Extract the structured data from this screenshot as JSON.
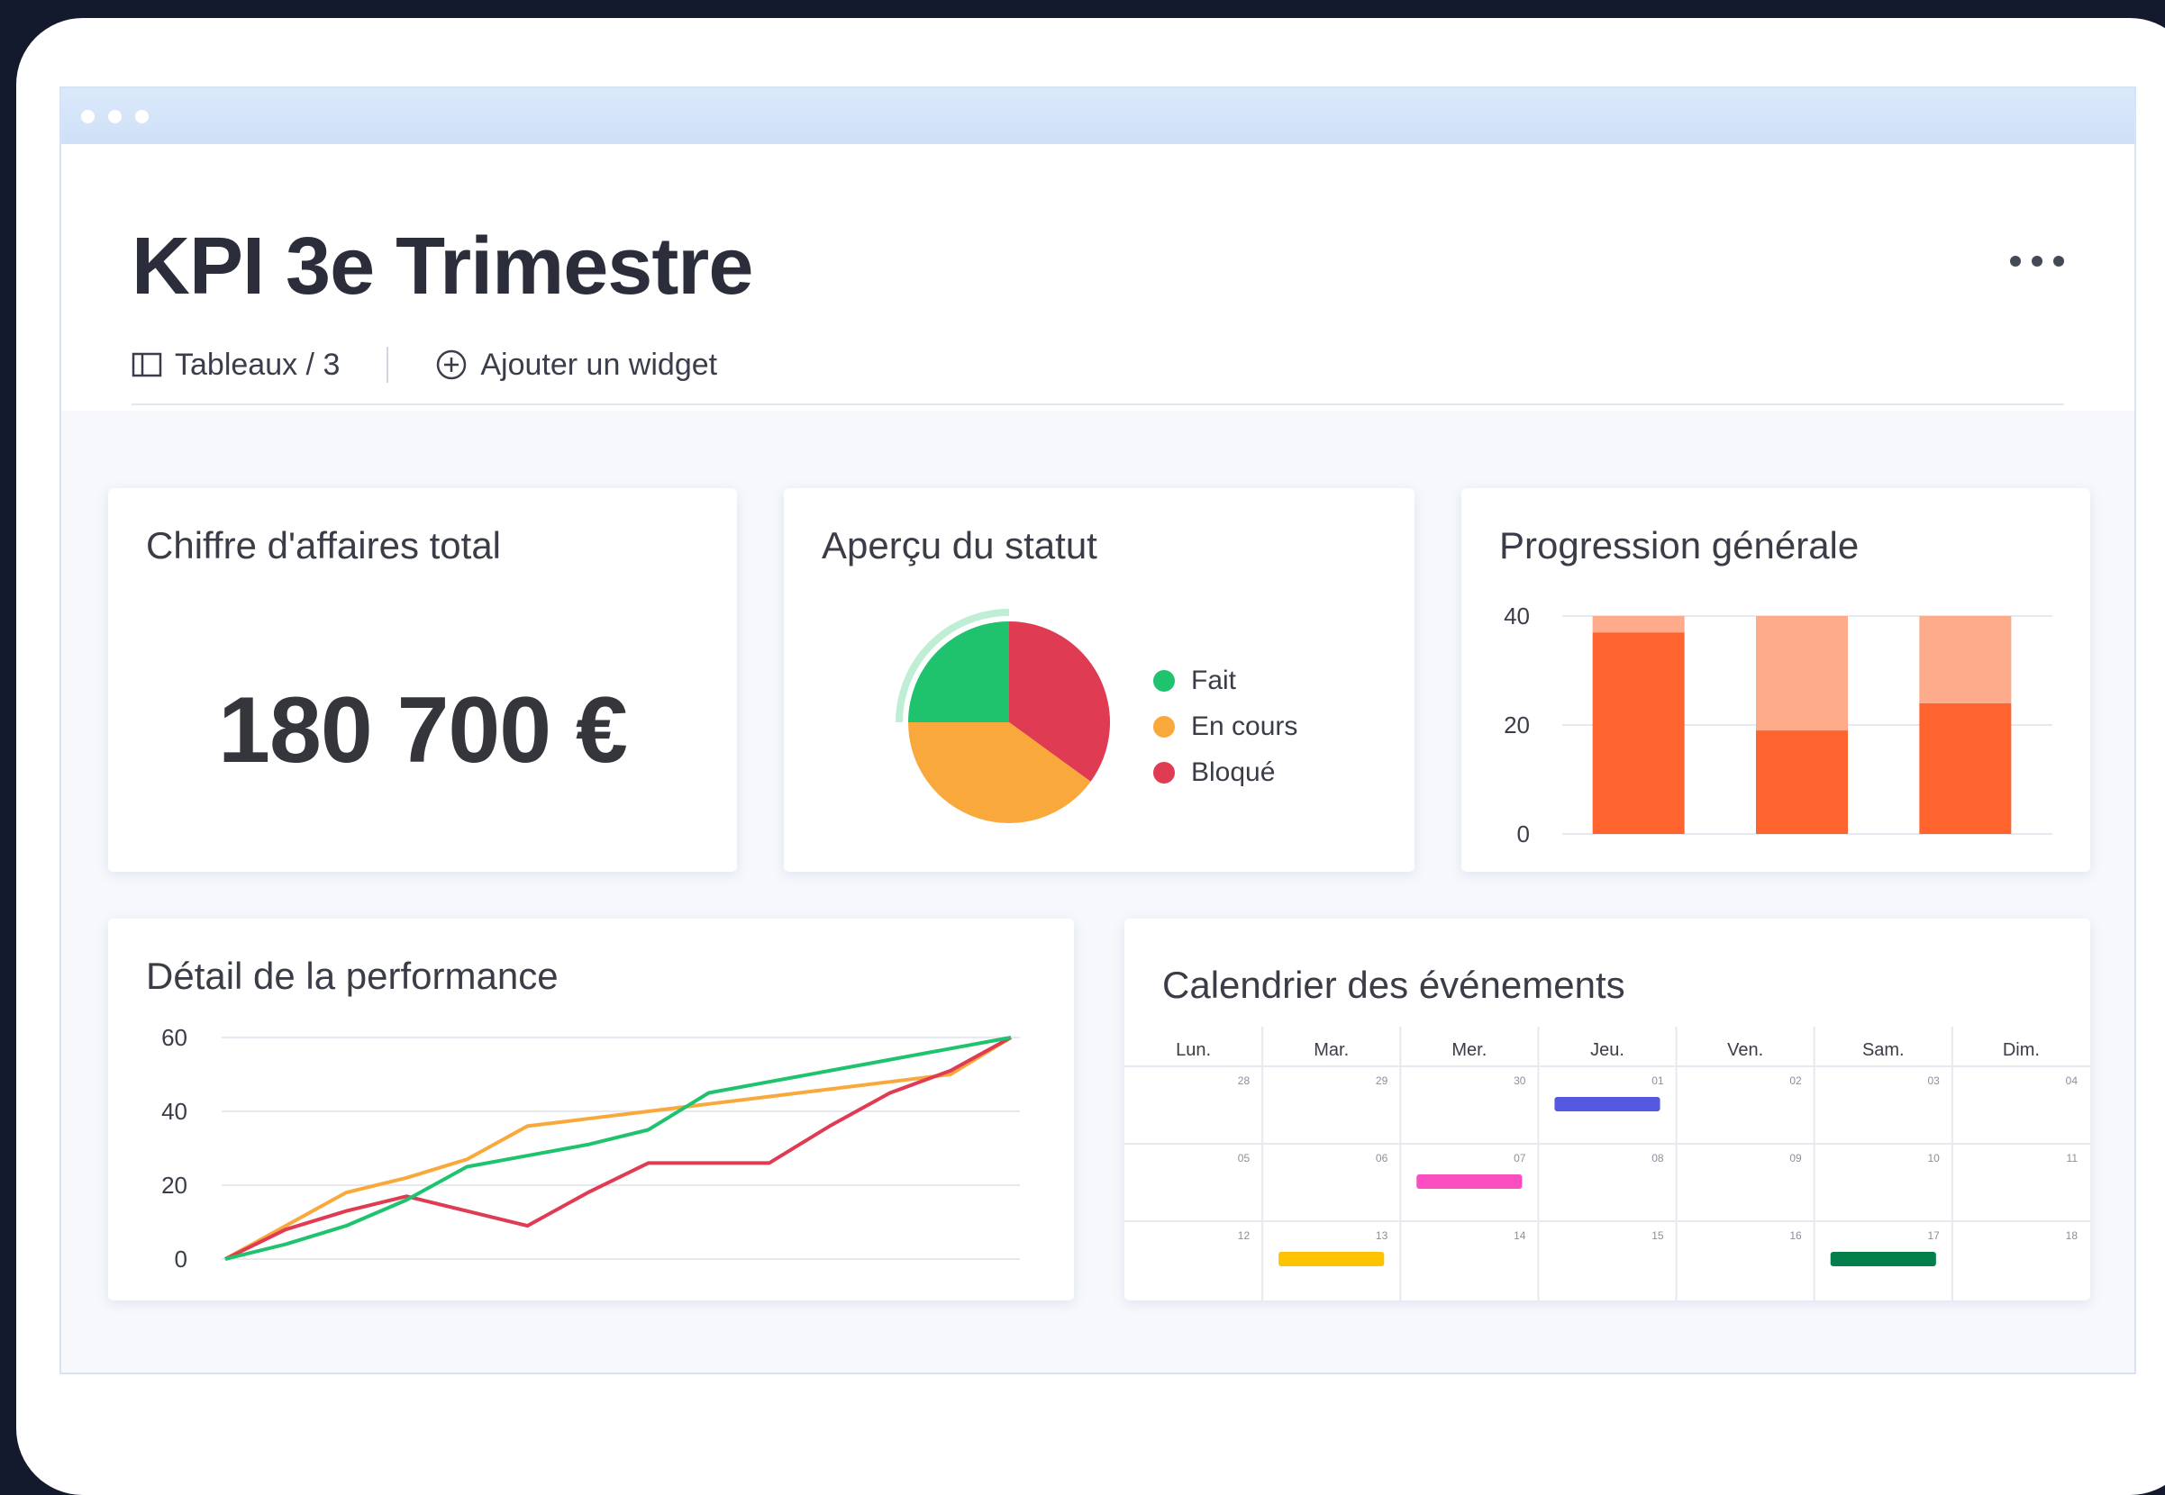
{
  "header": {
    "title": "KPI 3e Trimestre",
    "boards_label": "Tableaux / 3",
    "add_widget_label": "Ajouter un widget"
  },
  "revenue": {
    "title": "Chiffre d'affaires total",
    "value": "180 700 €"
  },
  "status": {
    "title": "Aperçu du statut",
    "legend": [
      {
        "label": "Fait",
        "color": "#1fc36e"
      },
      {
        "label": "En cours",
        "color": "#f9a93b"
      },
      {
        "label": "Bloqué",
        "color": "#df3b52"
      }
    ]
  },
  "progress": {
    "title": "Progression générale"
  },
  "performance": {
    "title": "Détail de la performance"
  },
  "calendar": {
    "title": "Calendrier des événements",
    "weekdays": [
      "Lun.",
      "Mar.",
      "Mer.",
      "Jeu.",
      "Ven.",
      "Sam.",
      "Dim."
    ],
    "weeks": [
      [
        "28",
        "29",
        "30",
        "01",
        "02",
        "03",
        "04"
      ],
      [
        "05",
        "06",
        "07",
        "08",
        "09",
        "10",
        "11"
      ],
      [
        "12",
        "13",
        "14",
        "15",
        "16",
        "17",
        "18"
      ]
    ],
    "events": [
      {
        "week": 0,
        "day": 3,
        "color": "#5559df"
      },
      {
        "week": 1,
        "day": 2,
        "color": "#fb4fc1"
      },
      {
        "week": 2,
        "day": 1,
        "color": "#fdc200"
      },
      {
        "week": 2,
        "day": 5,
        "color": "#037f4c"
      }
    ]
  },
  "chart_data": [
    {
      "type": "pie",
      "labels": [
        "Fait",
        "En cours",
        "Bloqué"
      ],
      "values": [
        25,
        40,
        35
      ],
      "colors": [
        "#1fc36e",
        "#f9a93b",
        "#df3b52"
      ]
    },
    {
      "type": "bar",
      "stacked": true,
      "categories": [
        "",
        "",
        ""
      ],
      "series": [
        {
          "values": [
            37,
            19,
            24
          ],
          "color": "#ff642e"
        },
        {
          "values": [
            3,
            21,
            16
          ],
          "color": "#fdab8b"
        }
      ],
      "yticks": [
        "0",
        "20",
        "40"
      ],
      "ylim": [
        0,
        40
      ],
      "grid": true
    },
    {
      "type": "line",
      "yticks": [
        "0",
        "20",
        "40",
        "60"
      ],
      "ylim": [
        0,
        60
      ],
      "grid": true,
      "series": [
        {
          "color": "#f9a93b",
          "x": [
            0,
            1,
            2,
            3,
            4,
            5,
            6,
            7,
            8,
            9,
            10,
            11,
            12,
            13
          ],
          "values": [
            0,
            9,
            18,
            22,
            27,
            36,
            38,
            40,
            42,
            44,
            46,
            48,
            50,
            60
          ]
        },
        {
          "color": "#df3b52",
          "x": [
            0,
            1,
            2,
            3,
            4,
            5,
            6,
            7,
            8,
            9,
            10,
            11,
            12,
            13
          ],
          "values": [
            0,
            8,
            13,
            17,
            13,
            9,
            18,
            26,
            26,
            26,
            36,
            45,
            51,
            60
          ]
        },
        {
          "color": "#1fc36e",
          "x": [
            0,
            1,
            2,
            3,
            4,
            5,
            6,
            7,
            8,
            9,
            10,
            11,
            12,
            13
          ],
          "values": [
            0,
            4,
            9,
            16,
            25,
            28,
            31,
            35,
            45,
            48,
            51,
            54,
            57,
            60
          ]
        }
      ]
    }
  ]
}
